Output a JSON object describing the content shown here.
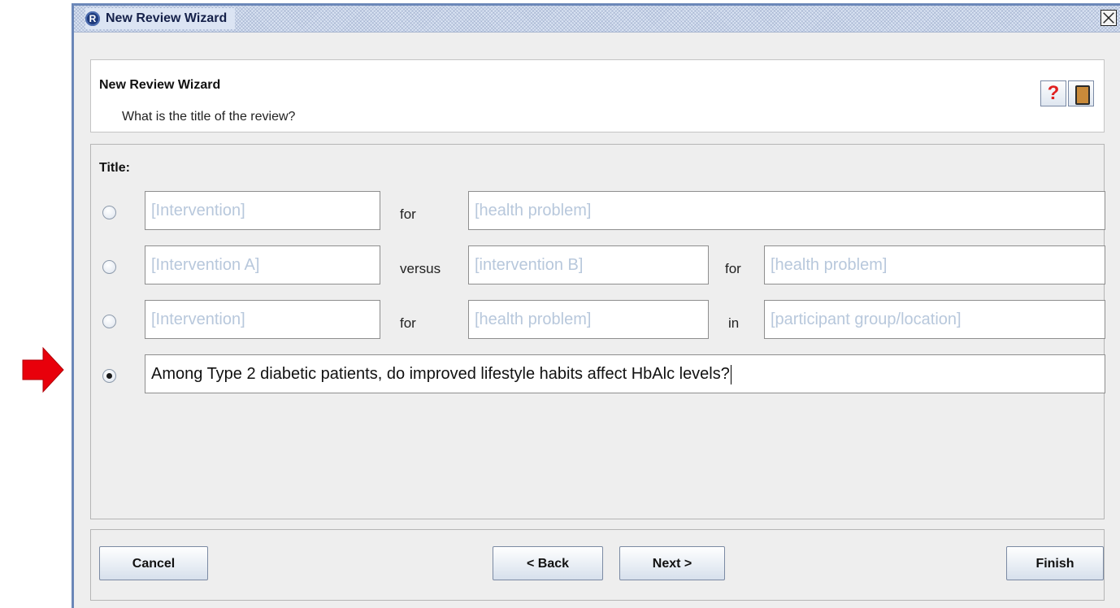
{
  "window": {
    "title": "New Review Wizard"
  },
  "header": {
    "title": "New Review Wizard",
    "subtitle": "What is the title of the review?",
    "help_icon": "help-icon",
    "book_icon": "book-icon"
  },
  "title_section": {
    "label": "Title:",
    "options": [
      {
        "selected": false,
        "field1_placeholder": "[Intervention]",
        "connector1": "for",
        "field2_placeholder": "[health problem]"
      },
      {
        "selected": false,
        "field1_placeholder": "[Intervention A]",
        "connector1": "versus",
        "field2_placeholder": "[intervention B]",
        "connector2": "for",
        "field3_placeholder": "[health problem]"
      },
      {
        "selected": false,
        "field1_placeholder": "[Intervention]",
        "connector1": "for",
        "field2_placeholder": "[health problem]",
        "connector2": "in",
        "field3_placeholder": "[participant group/location]"
      },
      {
        "selected": true,
        "value": "Among Type 2 diabetic patients, do improved lifestyle habits affect HbAlc levels?"
      }
    ]
  },
  "buttons": {
    "cancel": "Cancel",
    "back": "< Back",
    "next": "Next >",
    "finish": "Finish"
  },
  "colors": {
    "arrow": "#e8000b",
    "placeholder_text": "#b8c8dc",
    "window_border": "#6b87b8"
  }
}
